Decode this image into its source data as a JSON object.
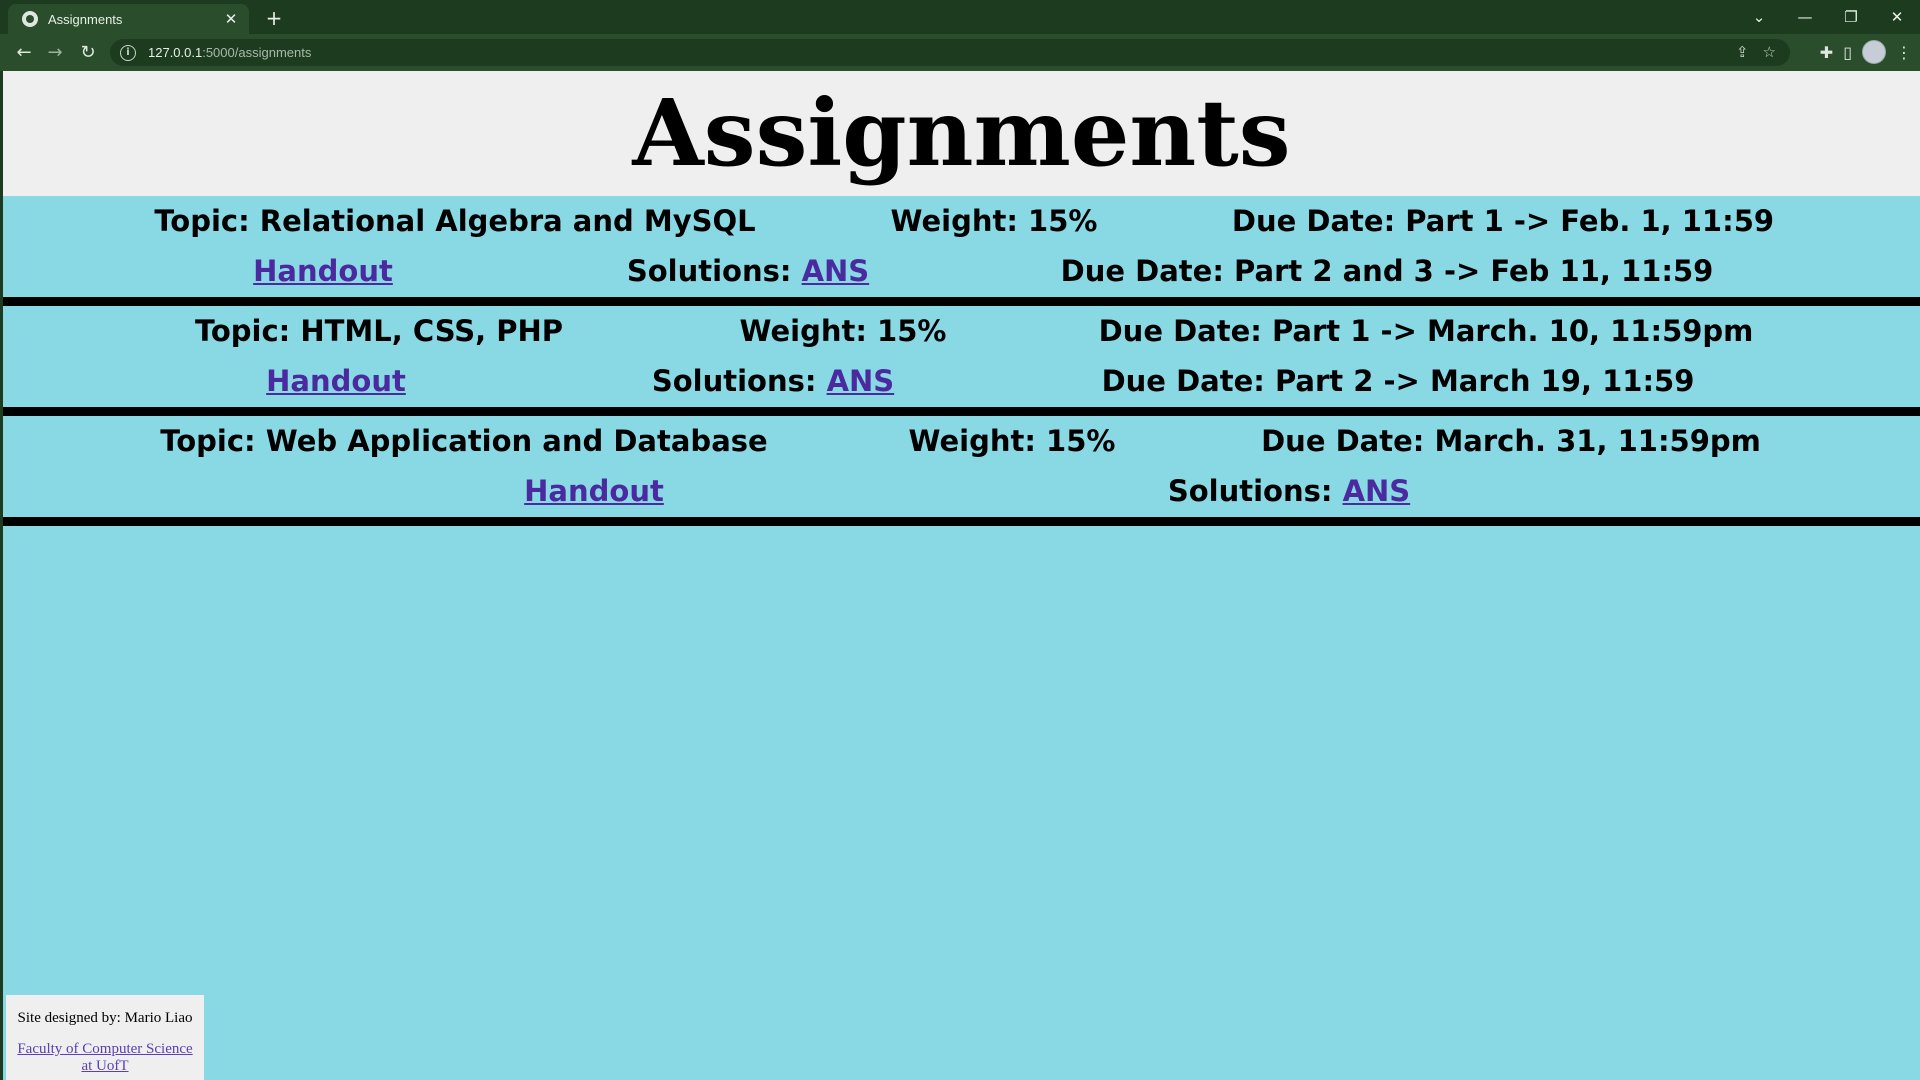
{
  "browser": {
    "tab_title": "Assignments",
    "url_host": "127.0.0.1",
    "url_path": ":5000/assignments"
  },
  "page": {
    "title": "Assignments"
  },
  "assignments": [
    {
      "topic": "Topic: Relational Algebra and MySQL",
      "weight": "Weight: 15%",
      "due1": "Due Date: Part 1 -> Feb. 1, 11:59",
      "handout": "Handout",
      "solutions_label": "Solutions:",
      "solutions_link": "ANS",
      "due2": "Due Date: Part 2 and 3 -> Feb 11, 11:59"
    },
    {
      "topic": "Topic: HTML, CSS, PHP",
      "weight": "Weight: 15%",
      "due1": "Due Date: Part 1 -> March. 10, 11:59pm",
      "handout": "Handout",
      "solutions_label": "Solutions:",
      "solutions_link": "ANS",
      "due2": "Due Date: Part 2 -> March 19, 11:59"
    },
    {
      "topic": "Topic: Web Application and Database",
      "weight": "Weight: 15%",
      "due1": "Due Date: March. 31, 11:59pm",
      "handout": "Handout",
      "solutions_label": "Solutions:",
      "solutions_link": "ANS"
    }
  ],
  "footer": {
    "designer": "Site designed by: Mario Liao",
    "faculty_line1": "Faculty of Computer Science",
    "faculty_line2": "at UofT"
  }
}
